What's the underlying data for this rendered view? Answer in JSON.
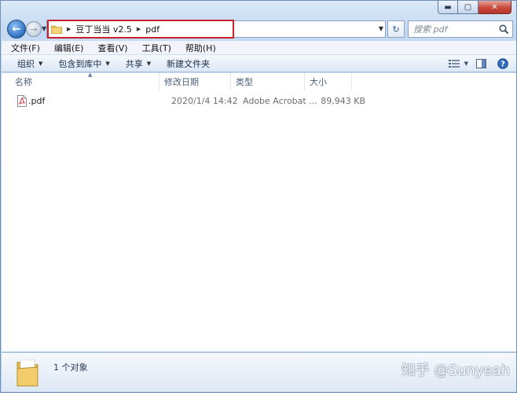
{
  "window": {
    "caption": {
      "minimize": "▬",
      "maximize": "▢",
      "close": "✕"
    }
  },
  "nav": {
    "back_glyph": "←",
    "forward_glyph": "→",
    "breadcrumbs": [
      "豆丁当当 v2.5",
      "pdf"
    ],
    "refresh_glyph": "↻",
    "search_placeholder": "搜索 pdf"
  },
  "menu": [
    "文件(F)",
    "编辑(E)",
    "查看(V)",
    "工具(T)",
    "帮助(H)"
  ],
  "toolbar": {
    "organize": "组织",
    "include_library": "包含到库中",
    "share": "共享",
    "new_folder": "新建文件夹",
    "help_glyph": "?"
  },
  "columns": {
    "name": "名称",
    "date": "修改日期",
    "type": "类型",
    "size": "大小"
  },
  "files": [
    {
      "name": ".pdf",
      "date": "2020/1/4 14:42",
      "type": "Adobe Acrobat ...",
      "size": "89,943 KB"
    }
  ],
  "status": {
    "count": "1 个对象"
  },
  "watermark": "知乎 @Sunyeah",
  "colors": {
    "highlight_box": "#c8202e",
    "pdf_red": "#c8202e",
    "folder": "#e7b84a"
  }
}
